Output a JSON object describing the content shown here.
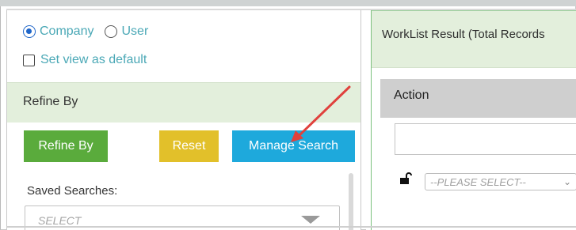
{
  "view_options": {
    "radio_company": "Company",
    "radio_user": "User",
    "set_default_label": "Set view as default"
  },
  "refine": {
    "header": "Refine By",
    "refine_button": "Refine By",
    "reset_button": "Reset",
    "manage_button": "Manage Search",
    "saved_searches_label": "Saved Searches:",
    "saved_searches_placeholder": "SELECT"
  },
  "worklist": {
    "title": "WorkList Result (Total Records",
    "action_header": "Action",
    "row_select_placeholder": "--PLEASE SELECT--"
  },
  "colors": {
    "refine_button": "#5aab3c",
    "reset_button": "#e2c02a",
    "manage_button": "#1ea9dc",
    "header_bg": "#e3efdc",
    "annotation_arrow": "#e0413d"
  }
}
